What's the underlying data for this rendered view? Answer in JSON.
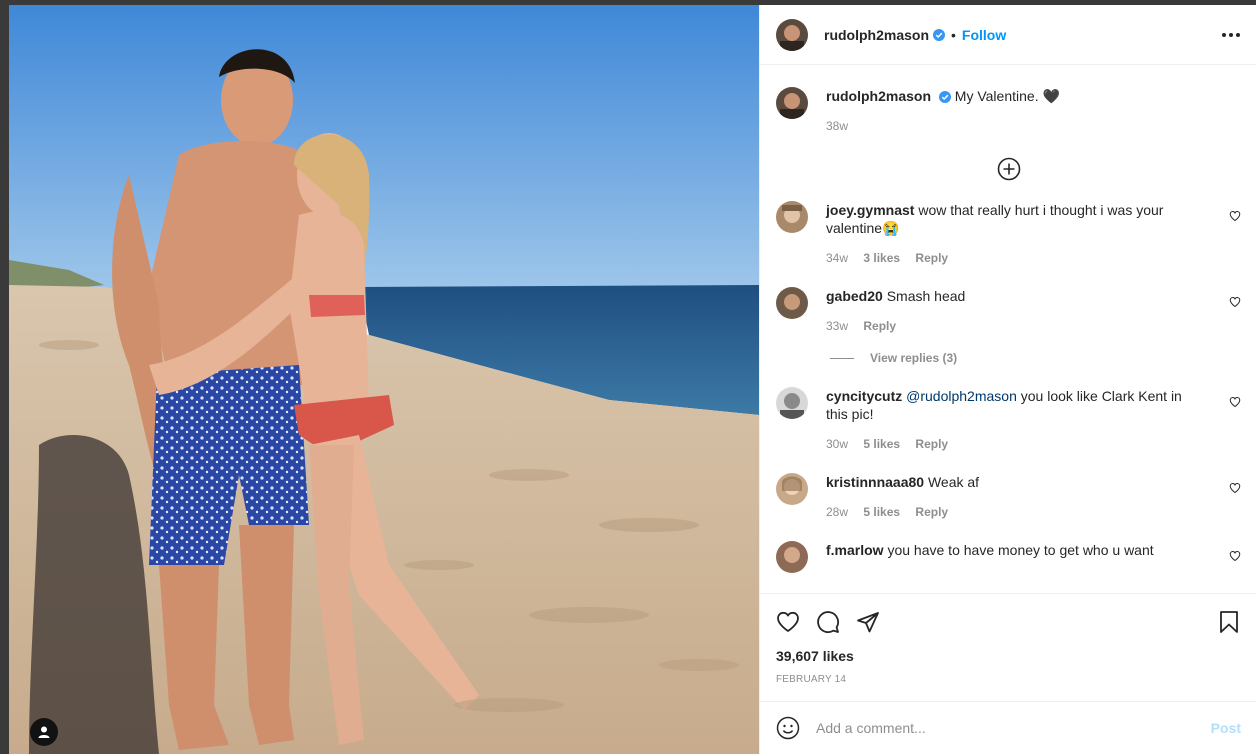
{
  "post": {
    "username": "rudolph2mason",
    "follow_label": "Follow",
    "dot": "•",
    "caption": "My Valentine. 🖤",
    "caption_time": "38w",
    "likes": "39,607 likes",
    "date": "FEBRUARY 14"
  },
  "comments": [
    {
      "user": "joey.gymnast",
      "text": "wow that really hurt i thought i was your valentine😭",
      "time": "34w",
      "likes": "3 likes",
      "reply": "Reply"
    },
    {
      "user": "gabed20",
      "text": "Smash head",
      "time": "33w",
      "likes": "",
      "reply": "Reply",
      "view_replies": "View replies (3)"
    },
    {
      "user": "cyncitycutz",
      "mention": "@rudolph2mason",
      "text": "you look like Clark Kent in this pic!",
      "time": "30w",
      "likes": "5 likes",
      "reply": "Reply"
    },
    {
      "user": "kristinnnaaa80",
      "text": "Weak af",
      "time": "28w",
      "likes": "5 likes",
      "reply": "Reply"
    },
    {
      "user": "f.marlow",
      "text": "you have to have money to get who u want",
      "time": "",
      "likes": "",
      "reply": ""
    }
  ],
  "composer": {
    "placeholder": "Add a comment...",
    "post_label": "Post"
  },
  "icons": [
    "more-options-icon",
    "verified-badge-icon",
    "load-more-icon",
    "heart-icon",
    "comment-icon",
    "share-icon",
    "bookmark-icon",
    "emoji-icon",
    "user-tag-icon"
  ],
  "colors": {
    "accent": "#0095f6",
    "muted": "#8e8e8e",
    "post_disabled": "#b2dffc"
  }
}
